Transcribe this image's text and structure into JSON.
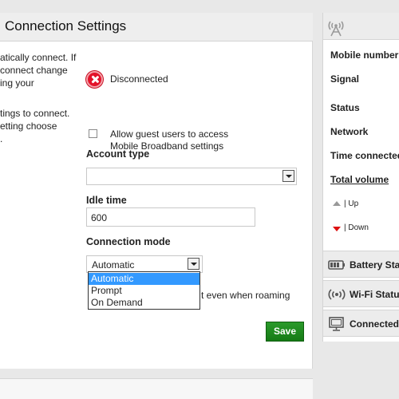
{
  "main": {
    "title": "Connection Settings",
    "left_text": [
      "atically connect. If",
      " connect change",
      "ing your",
      "tings to connect.",
      "etting choose",
      "."
    ],
    "status_text": "Disconnected",
    "guest_access_line1": "Allow guest users to access",
    "guest_access_line2": "Mobile Broadband settings",
    "account_type_label": "Account type",
    "account_type_value": "",
    "idle_time_label": "Idle time",
    "idle_time_value": "600",
    "connection_mode_label": "Connection mode",
    "connection_mode_value": "Automatic",
    "connection_mode_options": [
      "Automatic",
      "Prompt",
      "On Demand"
    ],
    "roaming_text": "t even when roaming",
    "save_label": "Save"
  },
  "side": {
    "rows": [
      "Mobile number",
      "Signal",
      "Status",
      "Network",
      "Time connected"
    ],
    "total_volume": "Total volume",
    "up_label": "| Up",
    "down_label": "| Down",
    "sections": [
      "Battery Sta",
      "Wi-Fi Status",
      "Connected"
    ]
  },
  "colors": {
    "save_green": "#1a861a",
    "selected_blue": "#3399ff",
    "disconnect_red": "#e3132a"
  }
}
